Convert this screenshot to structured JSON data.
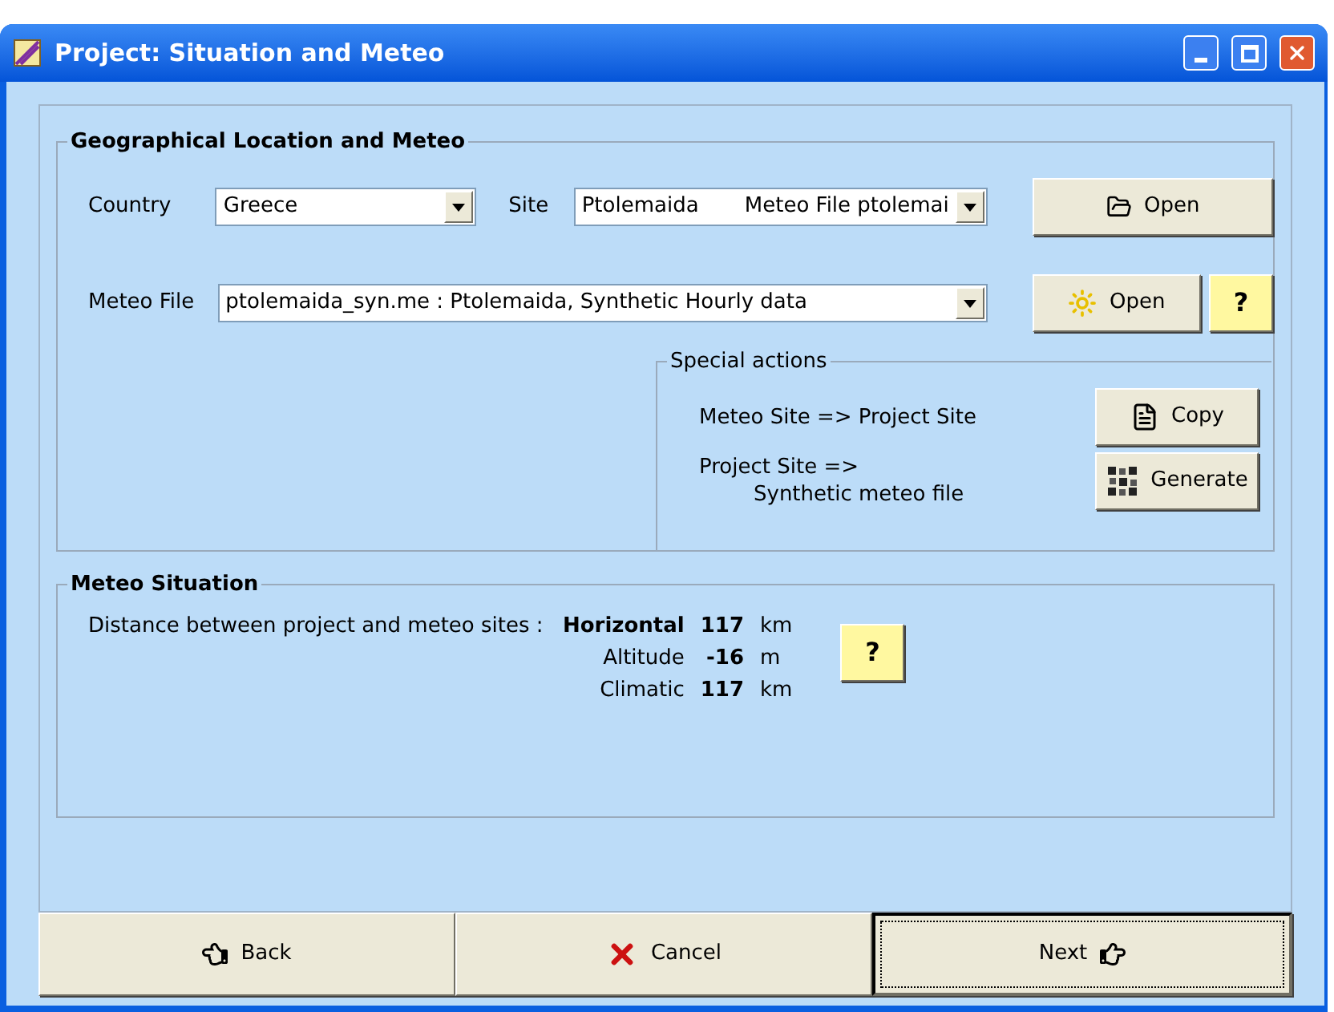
{
  "window": {
    "title": "Project: Situation and Meteo"
  },
  "geo_group": {
    "title": "Geographical Location and Meteo",
    "country": {
      "label": "Country",
      "value": "Greece"
    },
    "site": {
      "label": "Site",
      "value": "Ptolemaida",
      "detail": "Meteo File ptolemai"
    },
    "open_site_button": "Open",
    "meteo_file": {
      "label": "Meteo File",
      "value": "ptolemaida_syn.me : Ptolemaida, Synthetic Hourly data"
    },
    "open_meteo_button": "Open",
    "help_button": "?",
    "special_actions": {
      "title": "Special actions",
      "actions": [
        {
          "kind": "copy",
          "lines": [
            "Meteo Site => Project Site"
          ],
          "button": "Copy"
        },
        {
          "kind": "generate",
          "lines": [
            "Project Site =>",
            "Synthetic meteo file"
          ],
          "button": "Generate"
        }
      ]
    }
  },
  "meteo_situation": {
    "title": "Meteo Situation",
    "label": "Distance between project and meteo sites :",
    "rows": [
      {
        "name": "Horizontal",
        "emphasis": true,
        "value": "117",
        "unit": "km"
      },
      {
        "name": "Altitude",
        "emphasis": false,
        "value": "-16",
        "unit": "m"
      },
      {
        "name": "Climatic",
        "emphasis": false,
        "value": "117",
        "unit": "km"
      }
    ],
    "help_button": "?"
  },
  "footer_buttons": [
    {
      "kind": "back",
      "label": "Back",
      "focused": false
    },
    {
      "kind": "cancel",
      "label": "Cancel",
      "focused": false
    },
    {
      "kind": "next",
      "label": "Next",
      "focused": true
    }
  ]
}
